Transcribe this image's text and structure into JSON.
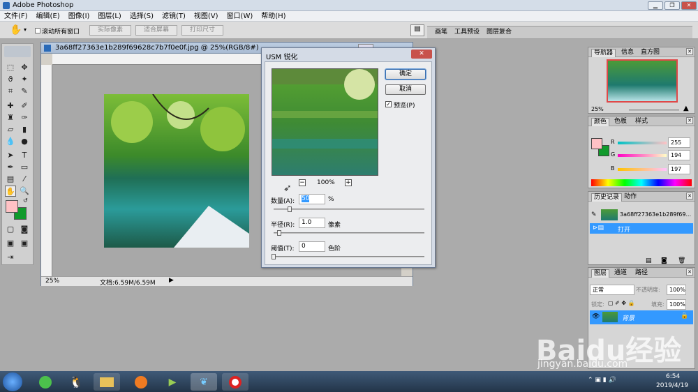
{
  "window": {
    "title": "Adobe Photoshop"
  },
  "menu": [
    "文件(F)",
    "编辑(E)",
    "图像(I)",
    "图层(L)",
    "选择(S)",
    "滤镜(T)",
    "视图(V)",
    "窗口(W)",
    "帮助(H)"
  ],
  "options": {
    "scroll_all_label": "滚动所有窗口",
    "actual_pixels": "实际像素",
    "fit_screen": "适合屏幕",
    "print_size": "打印尺寸",
    "tabs": [
      "画笔",
      "工具预设",
      "图层复合"
    ]
  },
  "document": {
    "title": "3a68ff27363e1b289f69628c7b7f0e0f.jpg @ 25%(RGB/8#)",
    "zoom": "25%",
    "doc_size": "文档:6.59M/6.59M"
  },
  "usm": {
    "title": "USM 锐化",
    "ok": "确定",
    "cancel": "取消",
    "preview_label": "预览(P)",
    "preview_checked": true,
    "zoom": "100%",
    "amount_label": "数量(A):",
    "amount_value": "50",
    "amount_unit": "%",
    "amount_fraction": 0.11,
    "radius_label": "半径(R):",
    "radius_value": "1.0",
    "radius_unit": "像素",
    "radius_fraction": 0.04,
    "threshold_label": "阈值(T):",
    "threshold_value": "0",
    "threshold_unit": "色阶",
    "threshold_fraction": 0.0
  },
  "navigator": {
    "tabs": [
      "导航器",
      "信息",
      "直方图"
    ],
    "zoom": "25%"
  },
  "color": {
    "tabs": [
      "颜色",
      "色板",
      "样式"
    ],
    "r_label": "R",
    "g_label": "G",
    "b_label": "B",
    "r": "255",
    "g": "194",
    "b": "197"
  },
  "history": {
    "tabs": [
      "历史记录",
      "动作"
    ],
    "snapshot": "3a68ff27363e1b289f69...",
    "step": "打开"
  },
  "layers": {
    "tabs": [
      "图层",
      "通道",
      "路径"
    ],
    "blend_mode": "正常",
    "opacity_label": "不透明度:",
    "opacity": "100%",
    "lock_label": "锁定:",
    "fill_label": "填充:",
    "fill": "100%",
    "layer_name": "背景"
  },
  "taskbar": {
    "time": "6:54",
    "date": "2019/4/19"
  },
  "watermark": {
    "text": "Baidu经验",
    "sub": "jingyan.baidu.com"
  },
  "colors": {
    "foreground": "#ffc2c5",
    "background": "#119a2c",
    "selection": "#3399ff"
  }
}
